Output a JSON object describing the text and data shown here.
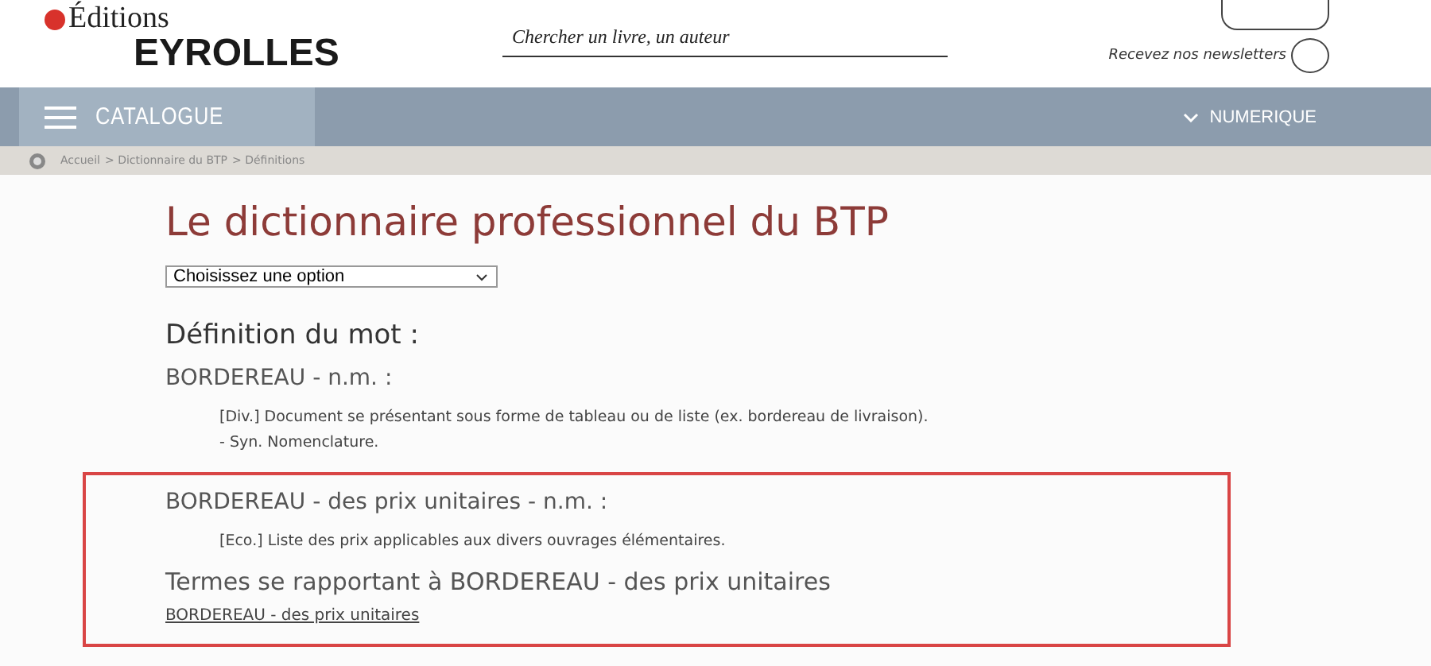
{
  "header": {
    "logo": {
      "top": "Éditions",
      "bottom": "EYROLLES"
    },
    "search": {
      "placeholder": "Chercher un livre, un auteur"
    },
    "newsletter": {
      "label": "Recevez nos newsletters",
      "checked": false
    }
  },
  "nav": {
    "menu": "CATALOGUE",
    "items": [
      {
        "label": "NUMERIQUE",
        "expanded": false
      }
    ]
  },
  "breadcrumb": [
    "Accueil",
    "> Dictionnaire du BTP",
    "> Définitions"
  ],
  "title": "Le dictionnaire professionnel du BTP",
  "select": {
    "value": "Choisissez une option"
  },
  "section_heading": "Définition du mot :",
  "sections": [
    {
      "highlighted": false,
      "blocks": [
        {
          "kind": "term",
          "text": "BORDEREAU - n.m. :"
        },
        {
          "kind": "definition",
          "lines": [
            "[Div.] Document se présentant sous forme de tableau ou de liste (ex. bordereau de livraison).",
            "- Syn. Nomenclature."
          ]
        }
      ]
    },
    {
      "highlighted": true,
      "blocks": [
        {
          "kind": "term",
          "text": "BORDEREAU - des prix unitaires - n.m. :"
        },
        {
          "kind": "definition",
          "lines": [
            "[Eco.] Liste des prix applicables aux divers ouvrages élémentaires."
          ]
        },
        {
          "kind": "related",
          "text": "Termes se rapportant à BORDEREAU - des prix unitaires"
        },
        {
          "kind": "link",
          "text": "BORDEREAU - des prix unitaires"
        }
      ]
    }
  ]
}
